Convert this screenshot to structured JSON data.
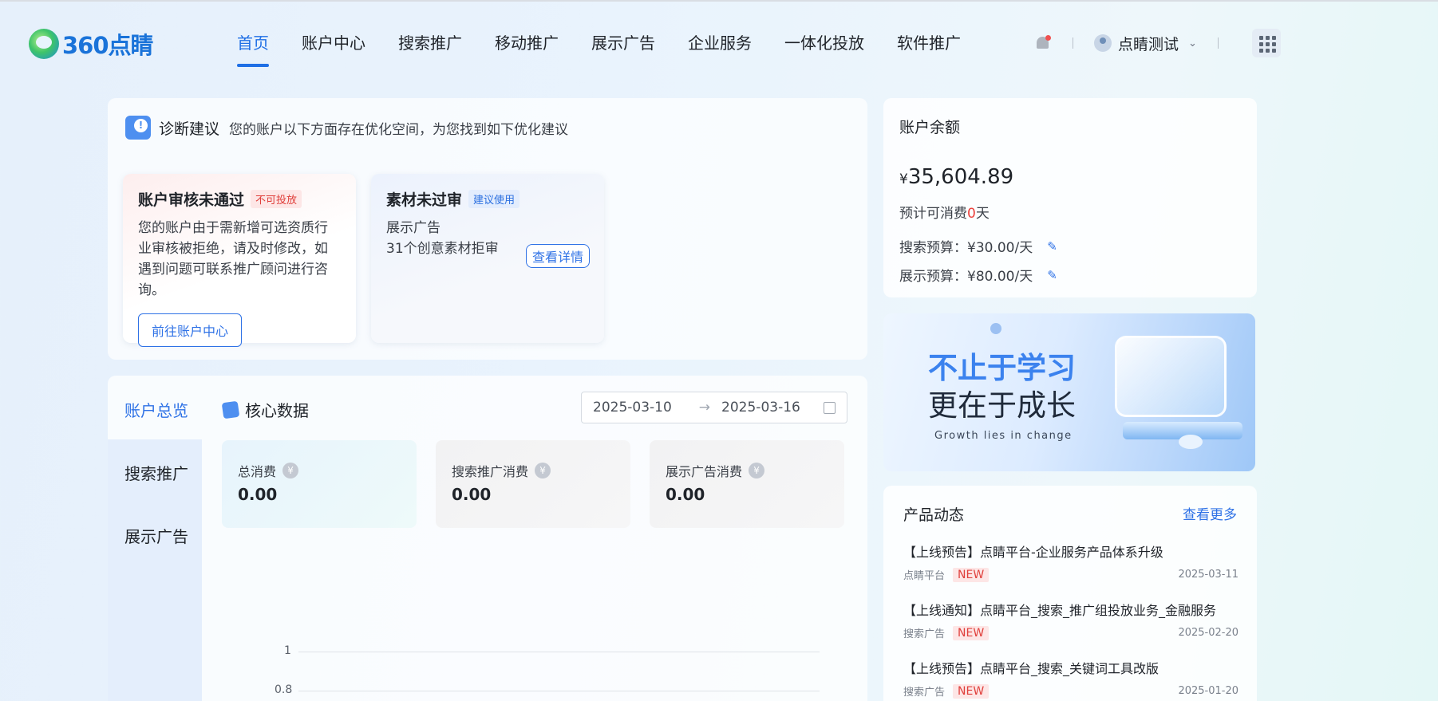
{
  "header": {
    "logo": "360点睛",
    "nav": [
      "首页",
      "账户中心",
      "搜索推广",
      "移动推广",
      "展示广告",
      "企业服务",
      "一体化投放",
      "软件推广"
    ],
    "active_nav": 0,
    "user_name": "点睛测试"
  },
  "diagnosis": {
    "title": "诊断建议",
    "subtitle": "您的账户以下方面存在优化空间，为您找到如下优化建议",
    "card1": {
      "title": "账户审核未通过",
      "tag": "不可投放",
      "body": "您的账户由于需新增可选资质行业审核被拒绝，请及时修改，如遇到问题可联系推广顾问进行咨询。",
      "button": "前往账户中心"
    },
    "card2": {
      "title": "素材未过审",
      "tag": "建议使用",
      "line1": "展示广告",
      "line2": "31个创意素材拒审",
      "button": "查看详情"
    }
  },
  "balance": {
    "title": "账户余额",
    "currency": "¥",
    "amount": "35,604.89",
    "days_prefix": "预计可消费",
    "days_value": "0",
    "days_suffix": "天",
    "search_budget": "搜索预算：¥30.00/天",
    "display_budget": "展示预算：¥80.00/天"
  },
  "banner": {
    "line1": "不止于学习",
    "line2": "更在于成长",
    "line3": "Growth lies in change"
  },
  "news": {
    "title": "产品动态",
    "more": "查看更多",
    "items": [
      {
        "title": "【上线预告】点睛平台-企业服务产品体系升级",
        "source": "点睛平台",
        "badge": "NEW",
        "date": "2025-03-11"
      },
      {
        "title": "【上线通知】点睛平台_搜索_推广组投放业务_金融服务",
        "source": "搜索广告",
        "badge": "NEW",
        "date": "2025-02-20"
      },
      {
        "title": "【上线预告】点睛平台_搜索_关键词工具改版",
        "source": "搜索广告",
        "badge": "NEW",
        "date": "2025-01-20"
      }
    ]
  },
  "core": {
    "side": [
      "账户总览",
      "搜索推广",
      "展示广告"
    ],
    "title": "核心数据",
    "date_start": "2025-03-10",
    "date_end": "2025-03-16",
    "kpis": [
      {
        "label": "总消费",
        "value": "0.00"
      },
      {
        "label": "搜索推广消费",
        "value": "0.00"
      },
      {
        "label": "展示广告消费",
        "value": "0.00"
      }
    ],
    "axis": [
      "1",
      "0.8"
    ],
    "yen_symbol": "¥"
  }
}
